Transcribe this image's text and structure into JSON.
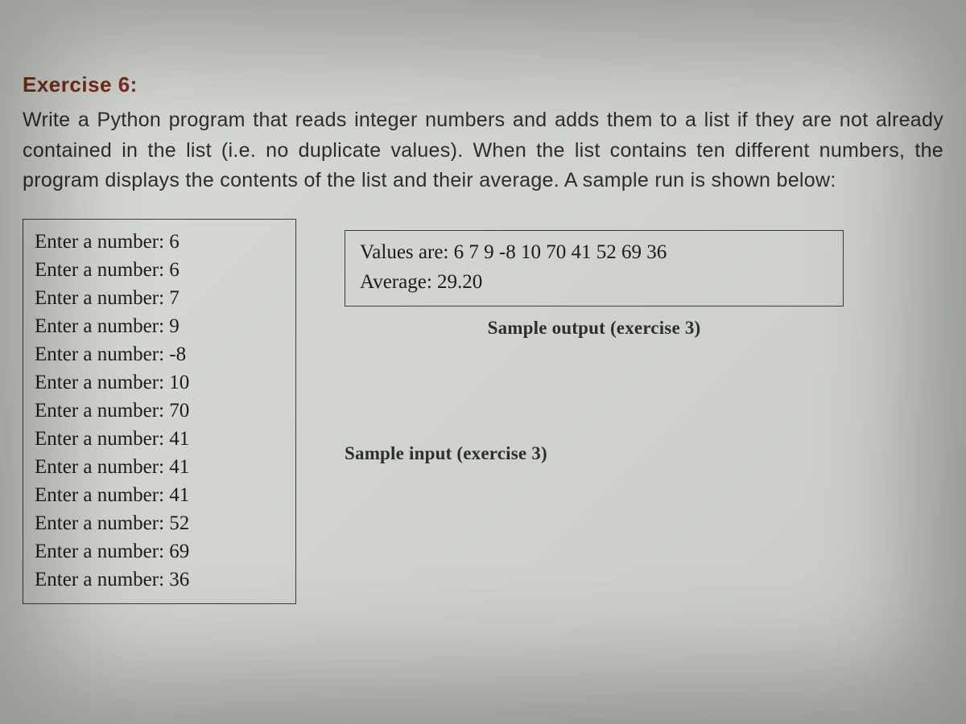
{
  "exercise": {
    "title": "Exercise 6:",
    "description": "Write a Python program that reads integer numbers and adds them to a list if they are not already contained in the list (i.e. no duplicate values). When the list contains ten different numbers, the program displays the contents of the list and their average. A sample run is shown below:"
  },
  "sample_input": {
    "lines": [
      "Enter a number: 6",
      "Enter a number: 6",
      "Enter a number: 7",
      "Enter a number: 9",
      "Enter a number: -8",
      "Enter a number: 10",
      "Enter a number: 70",
      "Enter a number: 41",
      "Enter a number: 41",
      "Enter a number: 41",
      "Enter a number: 52",
      "Enter a number: 69",
      "Enter a number: 36"
    ],
    "caption": "Sample input (exercise 3)"
  },
  "sample_output": {
    "values_line": "Values are:  6 7 9 -8 10 70 41 52 69 36",
    "average_line": "Average: 29.20",
    "caption": "Sample output (exercise 3)"
  }
}
